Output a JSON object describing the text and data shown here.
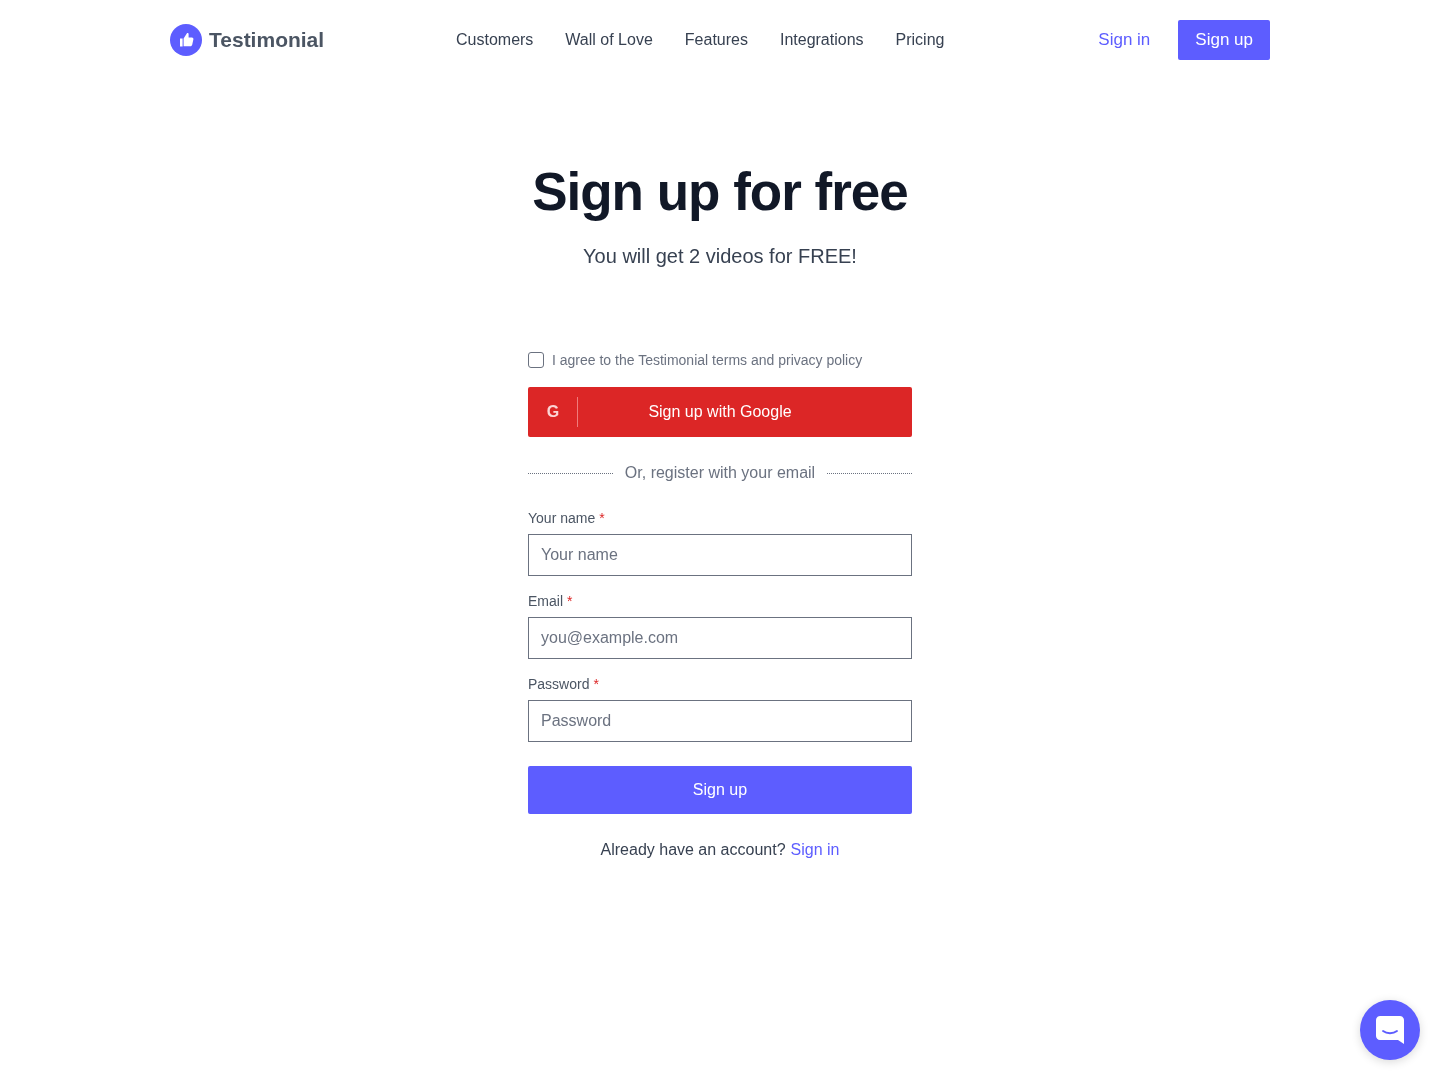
{
  "header": {
    "logo": "Testimonial",
    "nav": [
      "Customers",
      "Wall of Love",
      "Features",
      "Integrations",
      "Pricing"
    ],
    "sign_in": "Sign in",
    "sign_up": "Sign up"
  },
  "hero": {
    "title": "Sign up for free",
    "subtitle": "You will get 2 videos for FREE!"
  },
  "form": {
    "agree": {
      "label": "I agree to the Testimonial terms and privacy policy",
      "checked": false
    },
    "google_button": {
      "icon_text": "G",
      "label": "Sign up with Google"
    },
    "divider_text": "Or, register with your email",
    "fields": [
      {
        "label": "Your name",
        "required_mark": "*",
        "placeholder": "Your name"
      },
      {
        "label": "Email",
        "required_mark": "*",
        "placeholder": "you@example.com"
      },
      {
        "label": "Password",
        "required_mark": "*",
        "placeholder": "Password"
      }
    ],
    "submit": "Sign up",
    "footer": {
      "text": "Already have an account?",
      "link": "Sign in"
    }
  }
}
